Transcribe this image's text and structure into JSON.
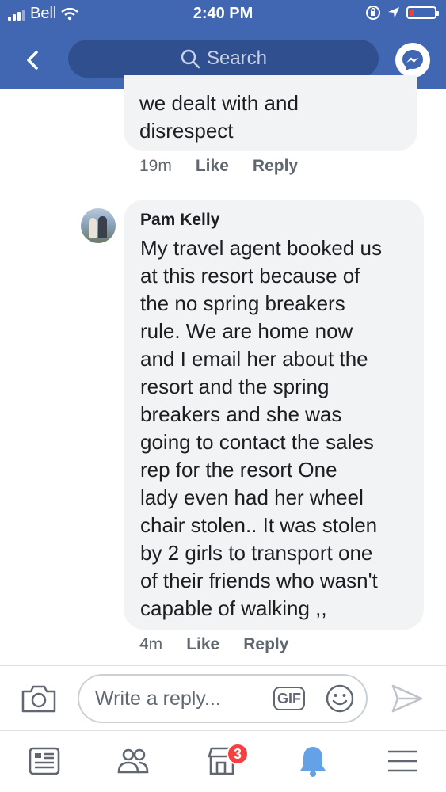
{
  "status_bar": {
    "carrier": "Bell",
    "time": "2:40 PM",
    "battery_level": 0.15
  },
  "nav": {
    "search_placeholder": "Search"
  },
  "comments": [
    {
      "text": "we dealt with and\ndisrespect",
      "time": "19m",
      "like_label": "Like",
      "reply_label": "Reply"
    },
    {
      "author": "Pam Kelly",
      "text": "My travel agent booked us\nat this resort because of\nthe no spring breakers\nrule.   We are home now\nand I email her about the\nresort and the spring\nbreakers and she was\ngoing to contact the sales\nrep for the resort   One\nlady even had her wheel\nchair stolen.. It was stolen\nby 2 girls to transport one\nof their friends who wasn't\ncapable of walking ,,",
      "time": "4m",
      "like_label": "Like",
      "reply_label": "Reply"
    }
  ],
  "composer": {
    "placeholder": "Write a reply...",
    "gif_label": "GIF"
  },
  "tabbar": {
    "marketplace_badge": "3"
  },
  "colors": {
    "brand": "#4267b2",
    "bubble": "#f2f3f5",
    "meta_text": "#606770",
    "badge": "#fa3e3e"
  },
  "icons": [
    "back-chevron-icon",
    "search-icon",
    "messenger-icon",
    "camera-icon",
    "gif-icon",
    "smiley-icon",
    "send-icon",
    "news-feed-icon",
    "friends-icon",
    "marketplace-icon",
    "notifications-icon",
    "menu-icon"
  ]
}
